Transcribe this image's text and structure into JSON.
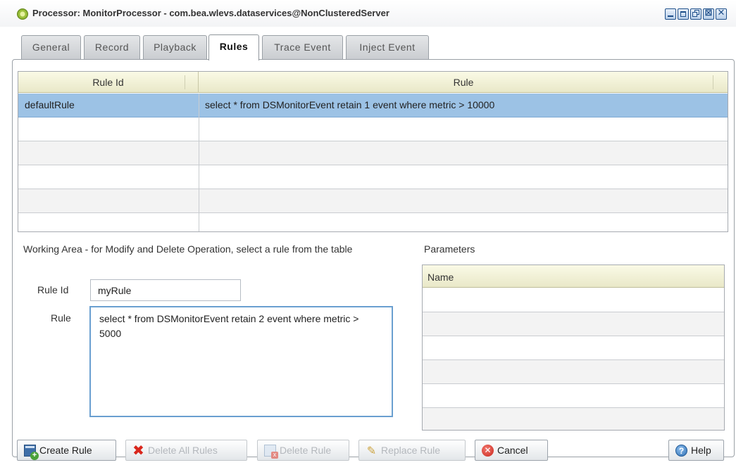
{
  "window": {
    "title": "Processor: MonitorProcessor - com.bea.wlevs.dataservices@NonClusteredServer",
    "controls": [
      "minimize-icon",
      "maximize-icon",
      "restore-icon",
      "detach-icon",
      "close-icon"
    ],
    "detach_glyph": "⊠",
    "close_glyph": "✕"
  },
  "tabs": [
    {
      "label": "General"
    },
    {
      "label": "Record"
    },
    {
      "label": "Playback"
    },
    {
      "label": "Rules",
      "active": true
    },
    {
      "label": "Trace Event"
    },
    {
      "label": "Inject Event"
    }
  ],
  "rules_table": {
    "columns": [
      "Rule Id",
      "Rule"
    ],
    "rows": [
      {
        "rule_id": "defaultRule",
        "rule": "select * from DSMonitorEvent retain 1 event where metric > 10000",
        "selected": true
      }
    ]
  },
  "working_area": {
    "label": "Working Area - for Modify and Delete Operation, select a rule from the table",
    "rule_id_label": "Rule Id",
    "rule_id_value": "myRule",
    "rule_label": "Rule",
    "rule_value": "select * from DSMonitorEvent retain 2 event where metric > 5000"
  },
  "parameters": {
    "label": "Parameters",
    "column": "Name"
  },
  "buttons": {
    "create_rule": {
      "label": "Create Rule",
      "enabled": true
    },
    "delete_all_rules": {
      "label": "Delete All Rules",
      "enabled": false
    },
    "delete_rule": {
      "label": "Delete Rule",
      "enabled": false
    },
    "replace_rule": {
      "label": "Replace Rule",
      "enabled": false
    },
    "cancel": {
      "label": "Cancel",
      "enabled": true
    },
    "help": {
      "label": "Help",
      "enabled": true
    }
  },
  "icons": {
    "delete_all_glyph": "✖",
    "replace_glyph": "✎",
    "cancel_glyph": "✕",
    "help_glyph": "?"
  },
  "colors": {
    "selected_row": "#9cc2e5",
    "focus_border": "#6a9fd0",
    "header_bg": "#f1f0d6"
  }
}
